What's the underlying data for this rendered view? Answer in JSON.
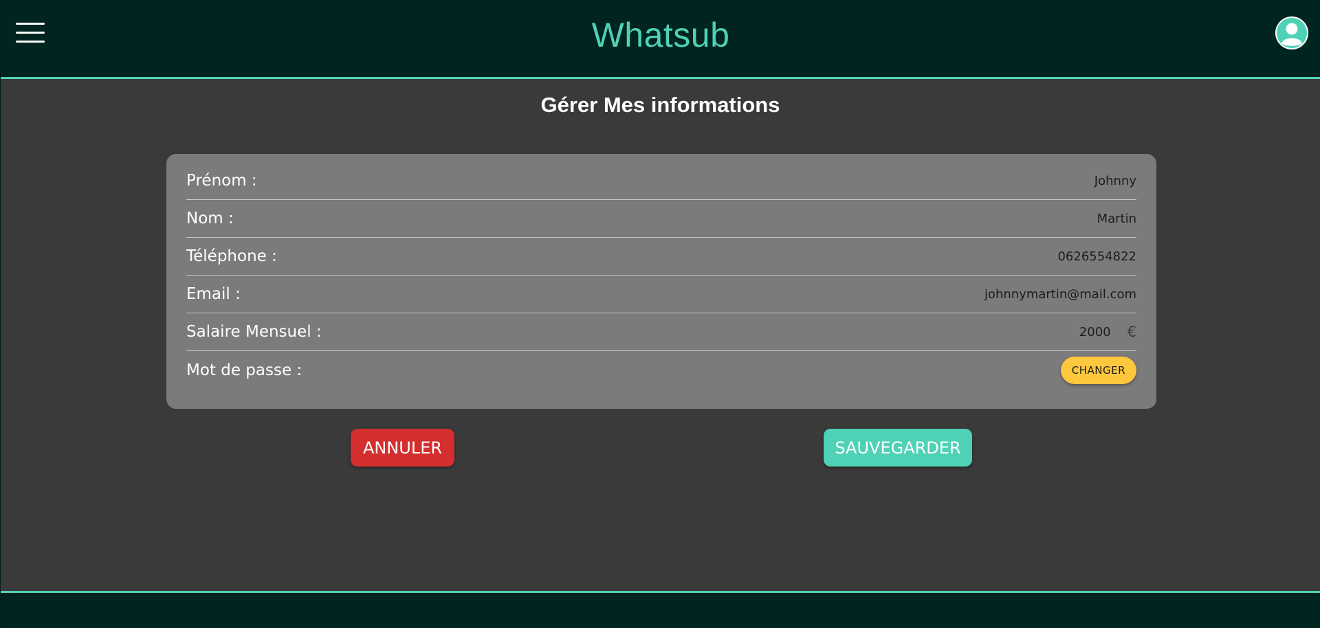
{
  "header": {
    "app_title": "Whatsub",
    "menu_icon": "hamburger-menu-icon",
    "avatar_icon": "user-avatar-icon"
  },
  "main": {
    "page_title": "Gérer Mes informations",
    "fields": [
      {
        "label": "Prénom :",
        "value": "Johnny"
      },
      {
        "label": "Nom :",
        "value": "Martin"
      },
      {
        "label": "Téléphone :",
        "value": "0626554822"
      },
      {
        "label": "Email :",
        "value": "johnnymartin@mail.com"
      },
      {
        "label": "Salaire Mensuel :",
        "value": "2000",
        "currency": "€"
      },
      {
        "label": "Mot de passe :",
        "button_label": "CHANGER"
      }
    ]
  },
  "actions": {
    "cancel_label": "ANNULER",
    "save_label": "SAUVEGARDER"
  },
  "colors": {
    "header_bg": "#002420",
    "accent": "#4fd1b5",
    "page_bg": "#3a3a3a",
    "card_bg": "#7b7b7b",
    "cancel": "#d32f2f",
    "change": "#fdc73e"
  }
}
